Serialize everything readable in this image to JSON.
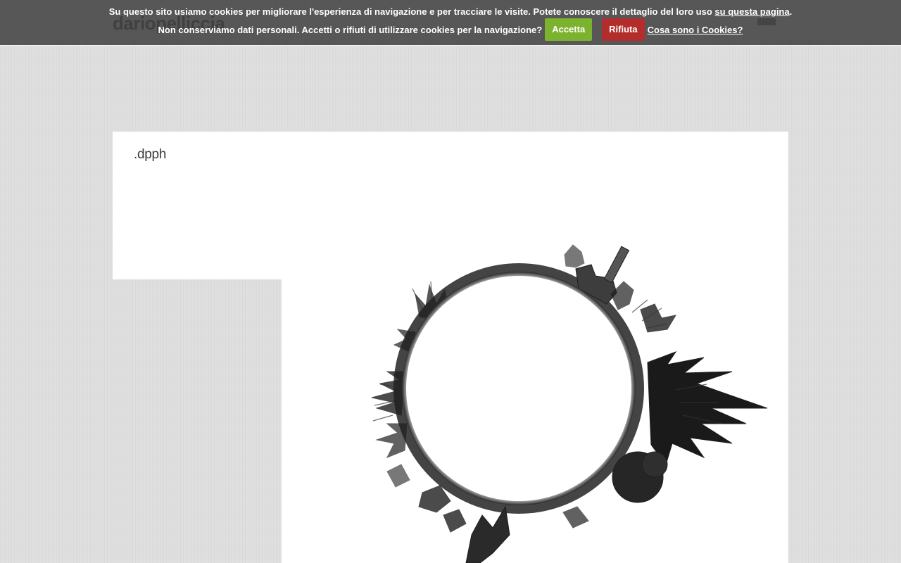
{
  "site": {
    "title": "dariopelliccia"
  },
  "cookie_bar": {
    "message_line1": "Su questo sito usiamo cookies per migliorare l'esperienza di navigazione e per tracciare le visite. Potete conoscere il dettaglio del loro uso",
    "policy_link": "su questa pagina",
    "period": ".",
    "message_line2": "Non conserviamo dati personali. Accetti o rifiuti di utilizzare cookies per la navigazione?",
    "accept_label": "Accetta",
    "reject_label": "Rifiuta",
    "info_link": "Cosa sono i Cookies?",
    "colors": {
      "bar_background": "#404040",
      "accept": "#7bb32e",
      "reject": "#b32d2d"
    }
  },
  "post": {
    "title": ".dpph"
  },
  "image": {
    "subject": "little-planet-panorama"
  },
  "colors": {
    "page_background": "#dedede",
    "card_background": "#ffffff",
    "title_text": "#3a3a3a"
  }
}
